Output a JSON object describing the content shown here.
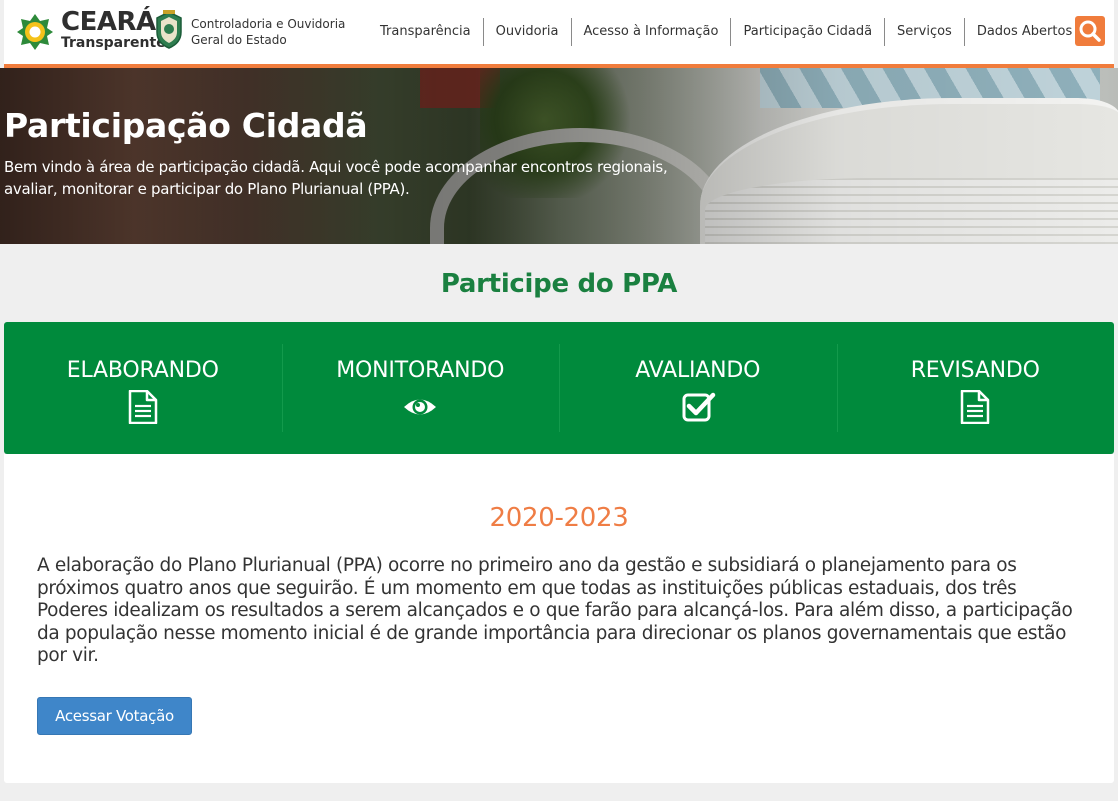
{
  "header": {
    "logo_main": "CEARÁ",
    "logo_sub": "Transparente",
    "org_name_line1": "Controladoria e Ouvidoria",
    "org_name_line2": "Geral do Estado",
    "nav": [
      "Transparência",
      "Ouvidoria",
      "Acesso à Informação",
      "Participação Cidadã",
      "Serviços",
      "Dados Abertos"
    ],
    "search_icon": "search-icon",
    "accent_color": "#f07c3c"
  },
  "hero": {
    "title": "Participação Cidadã",
    "subtitle_line1": "Bem vindo à área de participação cidadã. Aqui você pode acompanhar encontros regionais,",
    "subtitle_line2": "avaliar, monitorar e participar do Plano Plurianual (PPA)."
  },
  "main": {
    "section_title": "Participe do PPA",
    "phases": [
      {
        "label": "ELABORANDO",
        "icon": "document-icon"
      },
      {
        "label": "MONITORANDO",
        "icon": "eye-icon"
      },
      {
        "label": "AVALIANDO",
        "icon": "checkbox-icon"
      },
      {
        "label": "REVISANDO",
        "icon": "document-icon"
      }
    ],
    "period": "2020-2023",
    "description": "A elaboração do Plano Plurianual (PPA) ocorre no primeiro ano da gestão e subsidiará o planejamento para os próximos quatro anos que seguirão. É um momento em que todas as instituições públicas estaduais, dos três Poderes idealizam os resultados a serem alcançados e o que farão para alcançá-los. Para além disso, a participação da população nesse momento inicial é de grande importância para direcionar os planos governamentais que estão por vir.",
    "vote_button": "Acessar Votação"
  },
  "colors": {
    "green": "#008a3c",
    "title_green": "#1a8040",
    "period_orange": "#ef7d45",
    "button_blue": "#3f86c9"
  }
}
